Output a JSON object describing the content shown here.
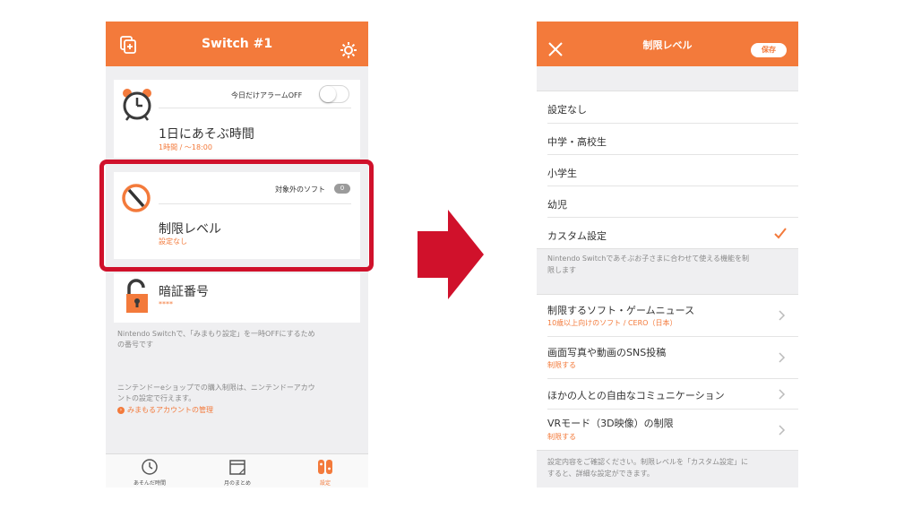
{
  "left": {
    "header": {
      "title": "Switch #1",
      "add_icon": "add-device-icon",
      "settings_icon": "gear-icon"
    },
    "alarm_card": {
      "icon": "alarm-clock-icon",
      "toggle_label": "今日だけアラームOFF",
      "toggle_on": false,
      "title": "1日にあそぶ時間",
      "subtitle": "1時間 / 〜18:00"
    },
    "restriction_card": {
      "icon": "prohibited-icon",
      "excluded_label": "対象外のソフト",
      "excluded_count": "0",
      "title": "制限レベル",
      "subtitle": "設定なし"
    },
    "pin_card": {
      "icon": "padlock-icon",
      "title": "暗証番号",
      "subtitle": "****"
    },
    "pin_note": [
      "Nintendo Switchで、「みまもり設定」を一時OFFにするため",
      "の番号です"
    ],
    "eshop_note": [
      "ニンテンドーeショップでの購入制限は、ニンテンドーアカウ",
      "ントの設定で行えます。"
    ],
    "account_link": "みまもるアカウントの管理",
    "tabs": [
      {
        "label": "あそんだ時間",
        "icon": "clock-icon",
        "active": false
      },
      {
        "label": "月のまとめ",
        "icon": "calendar-icon",
        "active": false
      },
      {
        "label": "設定",
        "icon": "switch-console-icon",
        "active": true
      }
    ]
  },
  "right": {
    "header": {
      "title": "制限レベル",
      "close_icon": "close-icon",
      "save_label": "保存"
    },
    "options": [
      {
        "label": "設定なし",
        "selected": false
      },
      {
        "label": "中学・高校生",
        "selected": false
      },
      {
        "label": "小学生",
        "selected": false
      },
      {
        "label": "幼児",
        "selected": false
      },
      {
        "label": "カスタム設定",
        "selected": true
      }
    ],
    "options_note": [
      "Nintendo Switchであそぶお子さまに合わせて使える機能を制",
      "限します"
    ],
    "items": [
      {
        "title": "制限するソフト・ゲームニュース",
        "subtitle": "10歳以上向けのソフト / CERO（日本）"
      },
      {
        "title": "画面写真や動画のSNS投稿",
        "subtitle": "制限する"
      },
      {
        "title": "ほかの人との自由なコミュニケーション",
        "subtitle": ""
      },
      {
        "title": "VRモード（3D映像）の制限",
        "subtitle": "制限する"
      }
    ],
    "bottom_note": [
      "設定内容をご確認ください。制限レベルを「カスタム設定」に",
      "すると、詳細な設定ができます。"
    ]
  },
  "colors": {
    "accent": "#f37a3b",
    "highlight": "#d0112b",
    "background": "#efeff1"
  }
}
